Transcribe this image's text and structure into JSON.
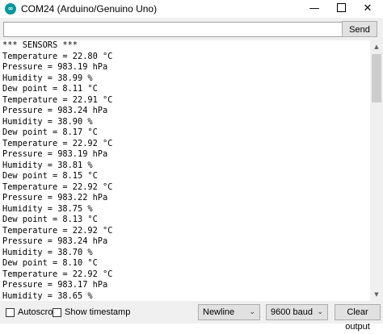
{
  "window": {
    "title": "COM24 (Arduino/Genuino Uno)",
    "icon": "arduino-icon",
    "min_glyph": "—",
    "close_glyph": "✕"
  },
  "input": {
    "value": "",
    "send_label": "Send"
  },
  "output_lines": [
    "*** SENSORS ***",
    "Temperature = 22.80 °C",
    "Pressure = 983.19 hPa",
    "Humidity = 38.99 %",
    "Dew point = 8.11 °C",
    "Temperature = 22.91 °C",
    "Pressure = 983.24 hPa",
    "Humidity = 38.90 %",
    "Dew point = 8.17 °C",
    "Temperature = 22.92 °C",
    "Pressure = 983.19 hPa",
    "Humidity = 38.81 %",
    "Dew point = 8.15 °C",
    "Temperature = 22.92 °C",
    "Pressure = 983.22 hPa",
    "Humidity = 38.75 %",
    "Dew point = 8.13 °C",
    "Temperature = 22.92 °C",
    "Pressure = 983.24 hPa",
    "Humidity = 38.70 %",
    "Dew point = 8.10 °C",
    "Temperature = 22.92 °C",
    "Pressure = 983.17 hPa",
    "Humidity = 38.65 %"
  ],
  "footer": {
    "autoscroll_label": "Autoscroll",
    "timestamp_label": "Show timestamp",
    "line_ending": "Newline",
    "baud": "9600 baud",
    "clear_label": "Clear output"
  }
}
